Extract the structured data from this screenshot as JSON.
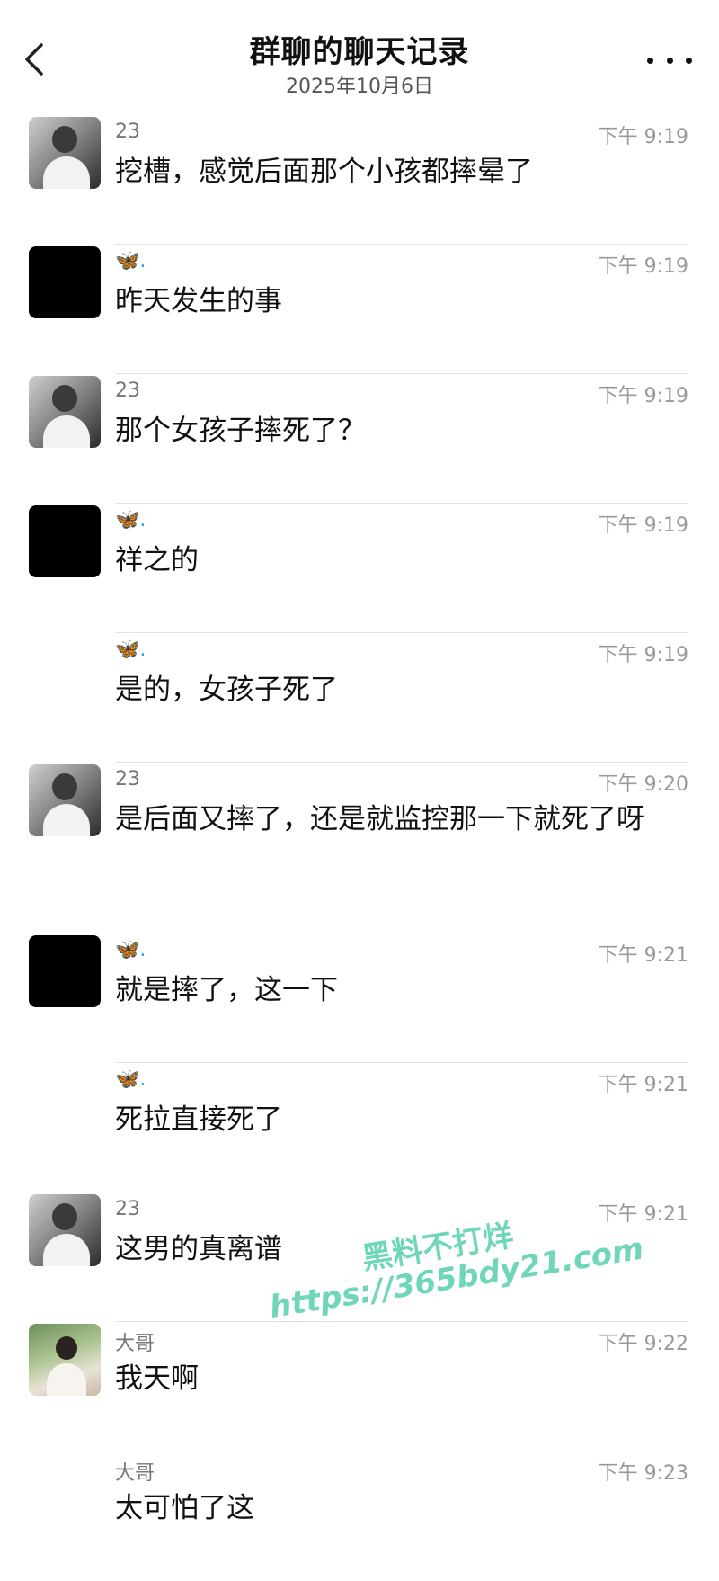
{
  "header": {
    "title": "群聊的聊天记录",
    "date": "2025年10月6日"
  },
  "messages": [
    {
      "sender": "23",
      "time": "下午 9:19",
      "text": "挖槽，感觉后面那个小孩都摔晕了"
    },
    {
      "sender": "🦋.",
      "time": "下午 9:19",
      "text": "昨天发生的事"
    },
    {
      "sender": "23",
      "time": "下午 9:19",
      "text": "那个女孩子摔死了？"
    },
    {
      "sender": "🦋.",
      "time": "下午 9:19",
      "text": "祥之的"
    },
    {
      "sender": "🦋.",
      "time": "下午 9:19",
      "text": "是的，女孩子死了"
    },
    {
      "sender": "23",
      "time": "下午 9:20",
      "text": "是后面又摔了，还是就监控那一下就死了呀"
    },
    {
      "sender": "🦋.",
      "time": "下午 9:21",
      "text": "就是摔了，这一下"
    },
    {
      "sender": "🦋.",
      "time": "下午 9:21",
      "text": "死拉直接死了"
    },
    {
      "sender": "23",
      "time": "下午 9:21",
      "text": "这男的真离谱"
    },
    {
      "sender": "大哥",
      "time": "下午 9:22",
      "text": "我天啊"
    },
    {
      "sender": "大哥",
      "time": "下午 9:23",
      "text": "太可怕了这"
    }
  ],
  "watermark": {
    "line1": "黑料不打烊",
    "line2": "https://365bdy21.com",
    "color": "#6fd6b9"
  },
  "icons": {
    "back": "chevron-left-icon",
    "more": "more-dots-icon",
    "butterfly": "butterfly-emoji"
  }
}
